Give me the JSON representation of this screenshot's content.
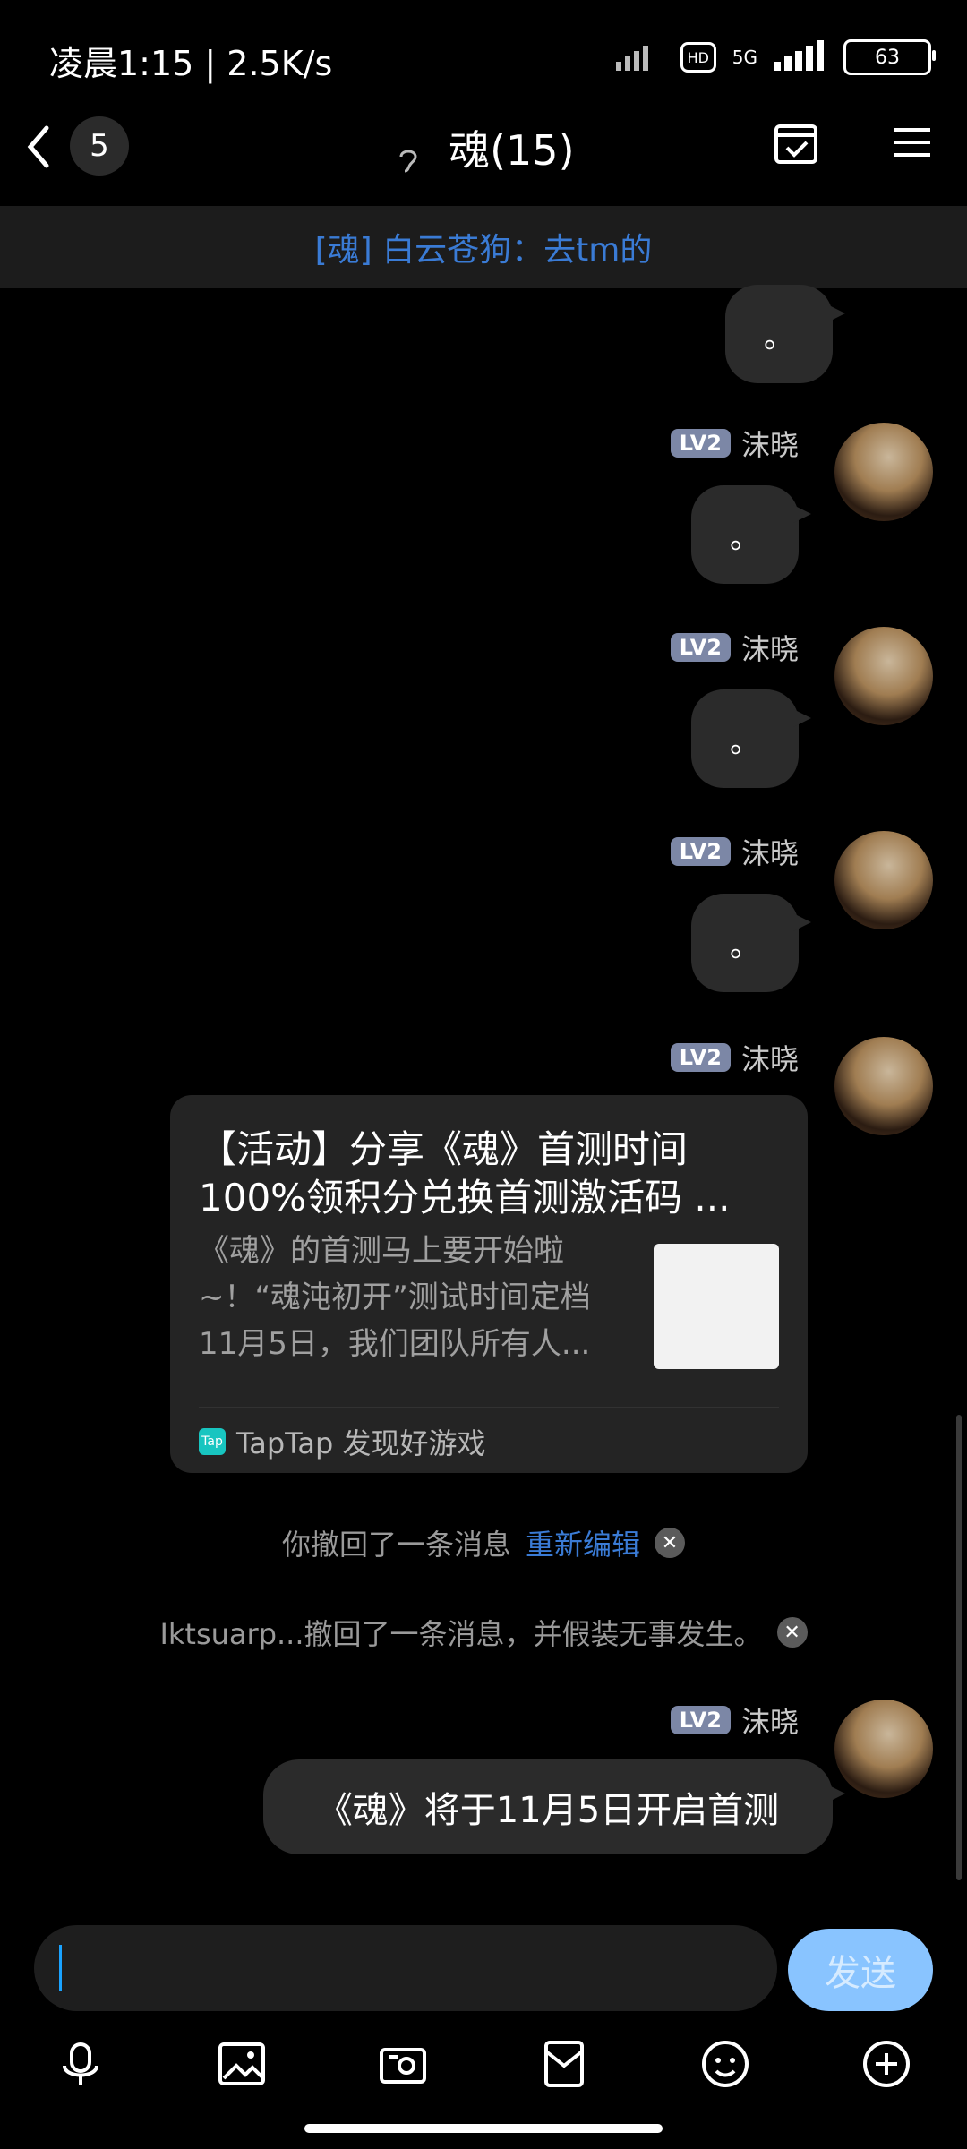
{
  "status": {
    "time": "凌晨1:15 | 2.5K/s",
    "network": "5G",
    "hd": "HD",
    "battery": "63"
  },
  "header": {
    "back_count": "5",
    "title": "魂(15)"
  },
  "notice": "[魂] 白云苍狗：去tm的",
  "chat": {
    "name": "沫晓",
    "level": "LV2",
    "dot_text": "。",
    "share_card": {
      "title": "【活动】分享《魂》首测时间100%领积分兑换首测激活码 ...",
      "desc": "《魂》的首测马上要开始啦~！“魂沌初开”测试时间定档11月5日，我们团队所有人...",
      "source": "TapTap 发现好游戏"
    },
    "withdraw_self": {
      "text": "你撤回了一条消息",
      "link": "重新编辑"
    },
    "withdraw_other": "Iktsuarp...撤回了一条消息，并假装无事发生。",
    "last_message": "《魂》将于11月5日开启首测"
  },
  "input": {
    "send_label": "发送"
  }
}
